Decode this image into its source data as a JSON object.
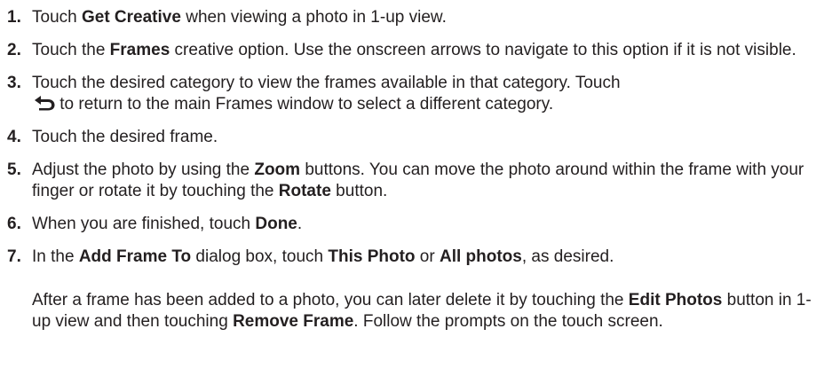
{
  "steps": [
    {
      "num": "1.",
      "parts": [
        "Touch ",
        "Get Creative",
        " when viewing a photo in 1-up view."
      ]
    },
    {
      "num": "2.",
      "parts": [
        "Touch the ",
        "Frames",
        " creative option. Use the onscreen arrows to navigate to this option if it is not visible."
      ]
    },
    {
      "num": "3.",
      "line1": "Touch the desired category to view the frames available in that category. Touch",
      "line2": " to return to the main Frames window to select a different category.",
      "icon": "back-arrow-icon"
    },
    {
      "num": "4.",
      "parts": [
        "Touch the desired frame."
      ]
    },
    {
      "num": "5.",
      "parts": [
        "Adjust the photo by using the ",
        "Zoom",
        " buttons. You can move the photo around within the frame with your finger or rotate it by touching the ",
        "Rotate",
        " button."
      ]
    },
    {
      "num": "6.",
      "parts": [
        "When you are finished, touch ",
        "Done",
        "."
      ]
    },
    {
      "num": "7.",
      "parts": [
        "In the ",
        "Add Frame To",
        " dialog box, touch ",
        "This Photo",
        " or ",
        "All photos",
        ", as desired."
      ]
    }
  ],
  "note": {
    "parts": [
      "After a frame has been added to a photo, you can later delete it by touching the ",
      "Edit Photos",
      " button in 1-up view and then touching ",
      "Remove Frame",
      ". Follow the prompts on the touch screen."
    ]
  }
}
